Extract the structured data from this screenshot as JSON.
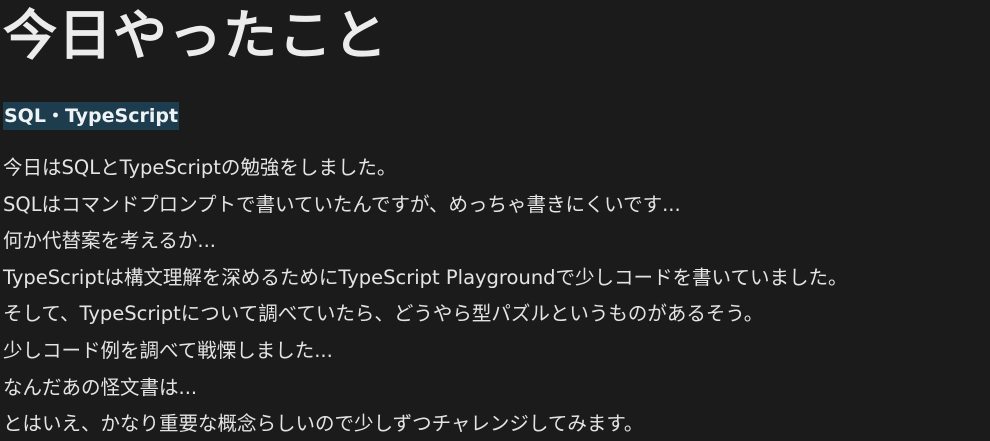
{
  "document": {
    "title": "今日やったこと",
    "section_label": "SQL・TypeScript",
    "lines": [
      "今日はSQLとTypeScriptの勉強をしました。",
      "SQLはコマンドプロンプトで書いていたんですが、めっちゃ書きにくいです...",
      "何か代替案を考えるか...",
      "TypeScriptは構文理解を深めるためにTypeScript Playgroundで少しコードを書いていました。",
      "そして、TypeScriptについて調べていたら、どうやら型パズルというものがあるそう。",
      "少しコード例を調べて戦慄しました...",
      "なんだあの怪文書は...",
      "とはいえ、かなり重要な概念らしいので少しずつチャレンジしてみます。"
    ]
  }
}
